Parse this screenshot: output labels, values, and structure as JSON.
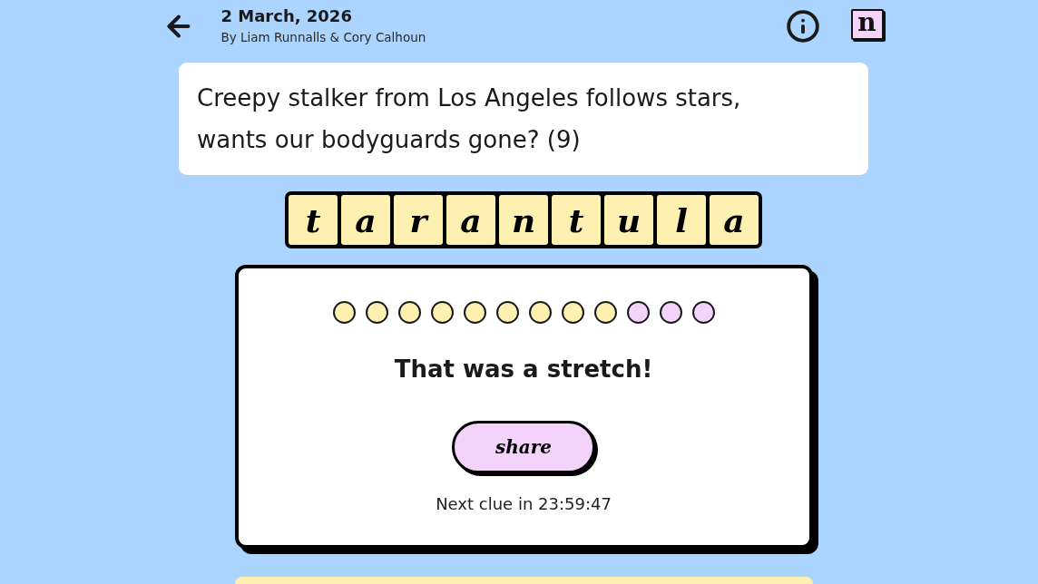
{
  "header": {
    "date": "2 March, 2026",
    "byline": "By Liam Runnalls & Cory Calhoun",
    "logo_mark": "n"
  },
  "clue": {
    "text": "Creepy stalker from Los Angeles follows stars, wants our bodyguards gone? (9)"
  },
  "answer": {
    "letters": [
      "t",
      "a",
      "r",
      "a",
      "n",
      "t",
      "u",
      "l",
      "a"
    ]
  },
  "result": {
    "progress_dots": [
      {
        "color": "#fdf0b0"
      },
      {
        "color": "#fdf0b0"
      },
      {
        "color": "#fdf0b0"
      },
      {
        "color": "#fdf0b0"
      },
      {
        "color": "#fdf0b0"
      },
      {
        "color": "#fdf0b0"
      },
      {
        "color": "#fdf0b0"
      },
      {
        "color": "#fdf0b0"
      },
      {
        "color": "#fdf0b0"
      },
      {
        "color": "#f4d3fb"
      },
      {
        "color": "#f4d3fb"
      },
      {
        "color": "#f4d3fb"
      }
    ],
    "message": "That was a stretch!",
    "share_button": "share",
    "next_clue": "Next clue in 23:59:47"
  }
}
